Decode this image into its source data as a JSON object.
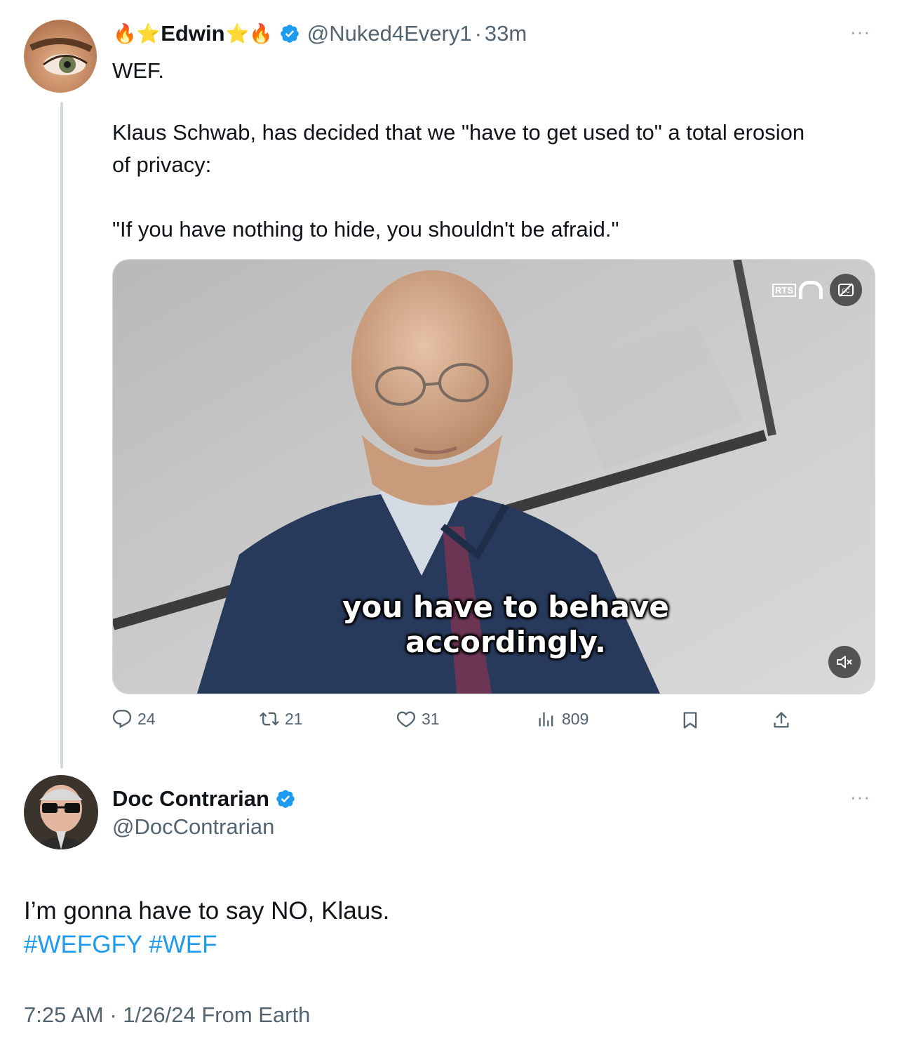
{
  "tweet1": {
    "name": "Edwin",
    "emoji_left": "🔥⭐",
    "emoji_right": "⭐🔥",
    "handle": "@Nuked4Every1",
    "separator": "·",
    "time": "33m",
    "more": "···",
    "text_line1": "WEF.",
    "text_line2": "Klaus Schwab, has decided that we \"have to get used to\" a total erosion",
    "text_line3": "of privacy:",
    "text_line4": "\"If you have nothing to hide, you shouldn't be afraid.\"",
    "video": {
      "subtitle_line1": "you have to behave",
      "subtitle_line2": "accordingly.",
      "watermark": "RTS"
    },
    "actions": {
      "replies": "24",
      "retweets": "21",
      "likes": "31",
      "views": "809"
    }
  },
  "tweet2": {
    "name": "Doc Contrarian",
    "handle": "@DocContrarian",
    "more": "···",
    "text": "I’m gonna have to say NO, Klaus.",
    "hashtag1": "#WEFGFY",
    "hashtag2": "#WEF",
    "timestamp": "7:25 AM · 1/26/24 From Earth"
  },
  "colors": {
    "accent": "#1d9bf0",
    "muted": "#536471",
    "text": "#0f1419",
    "thread_line": "#cfd9de"
  }
}
